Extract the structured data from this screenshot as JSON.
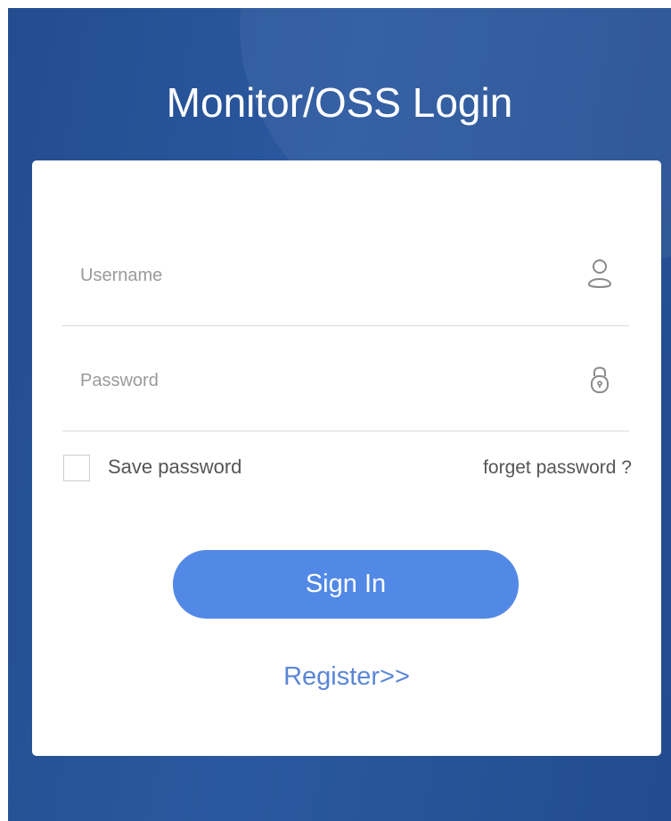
{
  "header": {
    "title": "Monitor/OSS Login"
  },
  "form": {
    "username_placeholder": "Username",
    "password_placeholder": "Password",
    "username_icon": "user-icon",
    "password_icon": "lock-icon",
    "save_password_label": "Save password",
    "forget_password_label": "forget password ?",
    "signin_label": "Sign In",
    "register_label": "Register>>"
  },
  "colors": {
    "background_primary": "#2a58a0",
    "button": "#5389e6",
    "link": "#5b86d6",
    "card": "#ffffff"
  }
}
